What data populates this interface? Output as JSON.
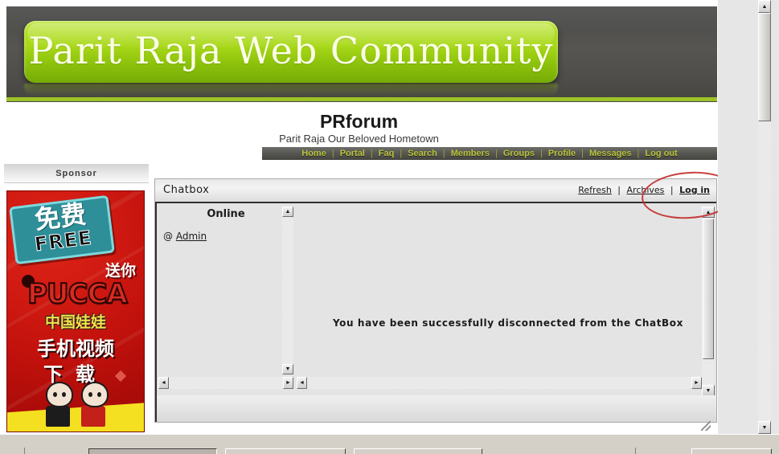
{
  "banner": {
    "logo_text": "Parit Raja Web Community",
    "bg_color": "#4f4e4b",
    "plate_color": "#a8d818",
    "stripe_color": "#9dc227"
  },
  "site": {
    "title": "PRforum",
    "tagline": "Parit Raja Our Beloved Hometown"
  },
  "nav": {
    "accent_color": "#b8c23a",
    "separator": "|",
    "items": [
      {
        "label": "Home"
      },
      {
        "label": "Portal"
      },
      {
        "label": "Faq"
      },
      {
        "label": "Search"
      },
      {
        "label": "Members"
      },
      {
        "label": "Groups"
      },
      {
        "label": "Profile"
      },
      {
        "label": "Messages"
      },
      {
        "label": "Log out"
      }
    ]
  },
  "sponsor": {
    "header": "Sponsor",
    "ad": {
      "badge_cn": "免费",
      "badge_en": "FREE",
      "tagline_cn": "送你",
      "brand": "PUCCA",
      "line_cn_1": "中国娃娃",
      "line_cn_2": "手机视频",
      "line_cn_3": "下载",
      "bg_color": "#c1110c",
      "badge_color": "#2e8f99"
    }
  },
  "chatbox": {
    "title": "Chatbox",
    "links": [
      {
        "label": "Refresh",
        "bold": false
      },
      {
        "label": "Archives",
        "bold": false
      },
      {
        "label": "Log in",
        "bold": true
      }
    ],
    "online": {
      "heading": "Online",
      "prefix": "@",
      "users": [
        {
          "name": "Admin"
        }
      ]
    },
    "message": "You have been successfully disconnected from the ChatBox"
  },
  "annotation": {
    "target": "Log in",
    "color": "#c22b2b",
    "shape": "ellipse"
  },
  "scrollbars": {
    "up_arrow": "▲",
    "down_arrow": "▼",
    "left_arrow": "◄",
    "right_arrow": "►"
  }
}
